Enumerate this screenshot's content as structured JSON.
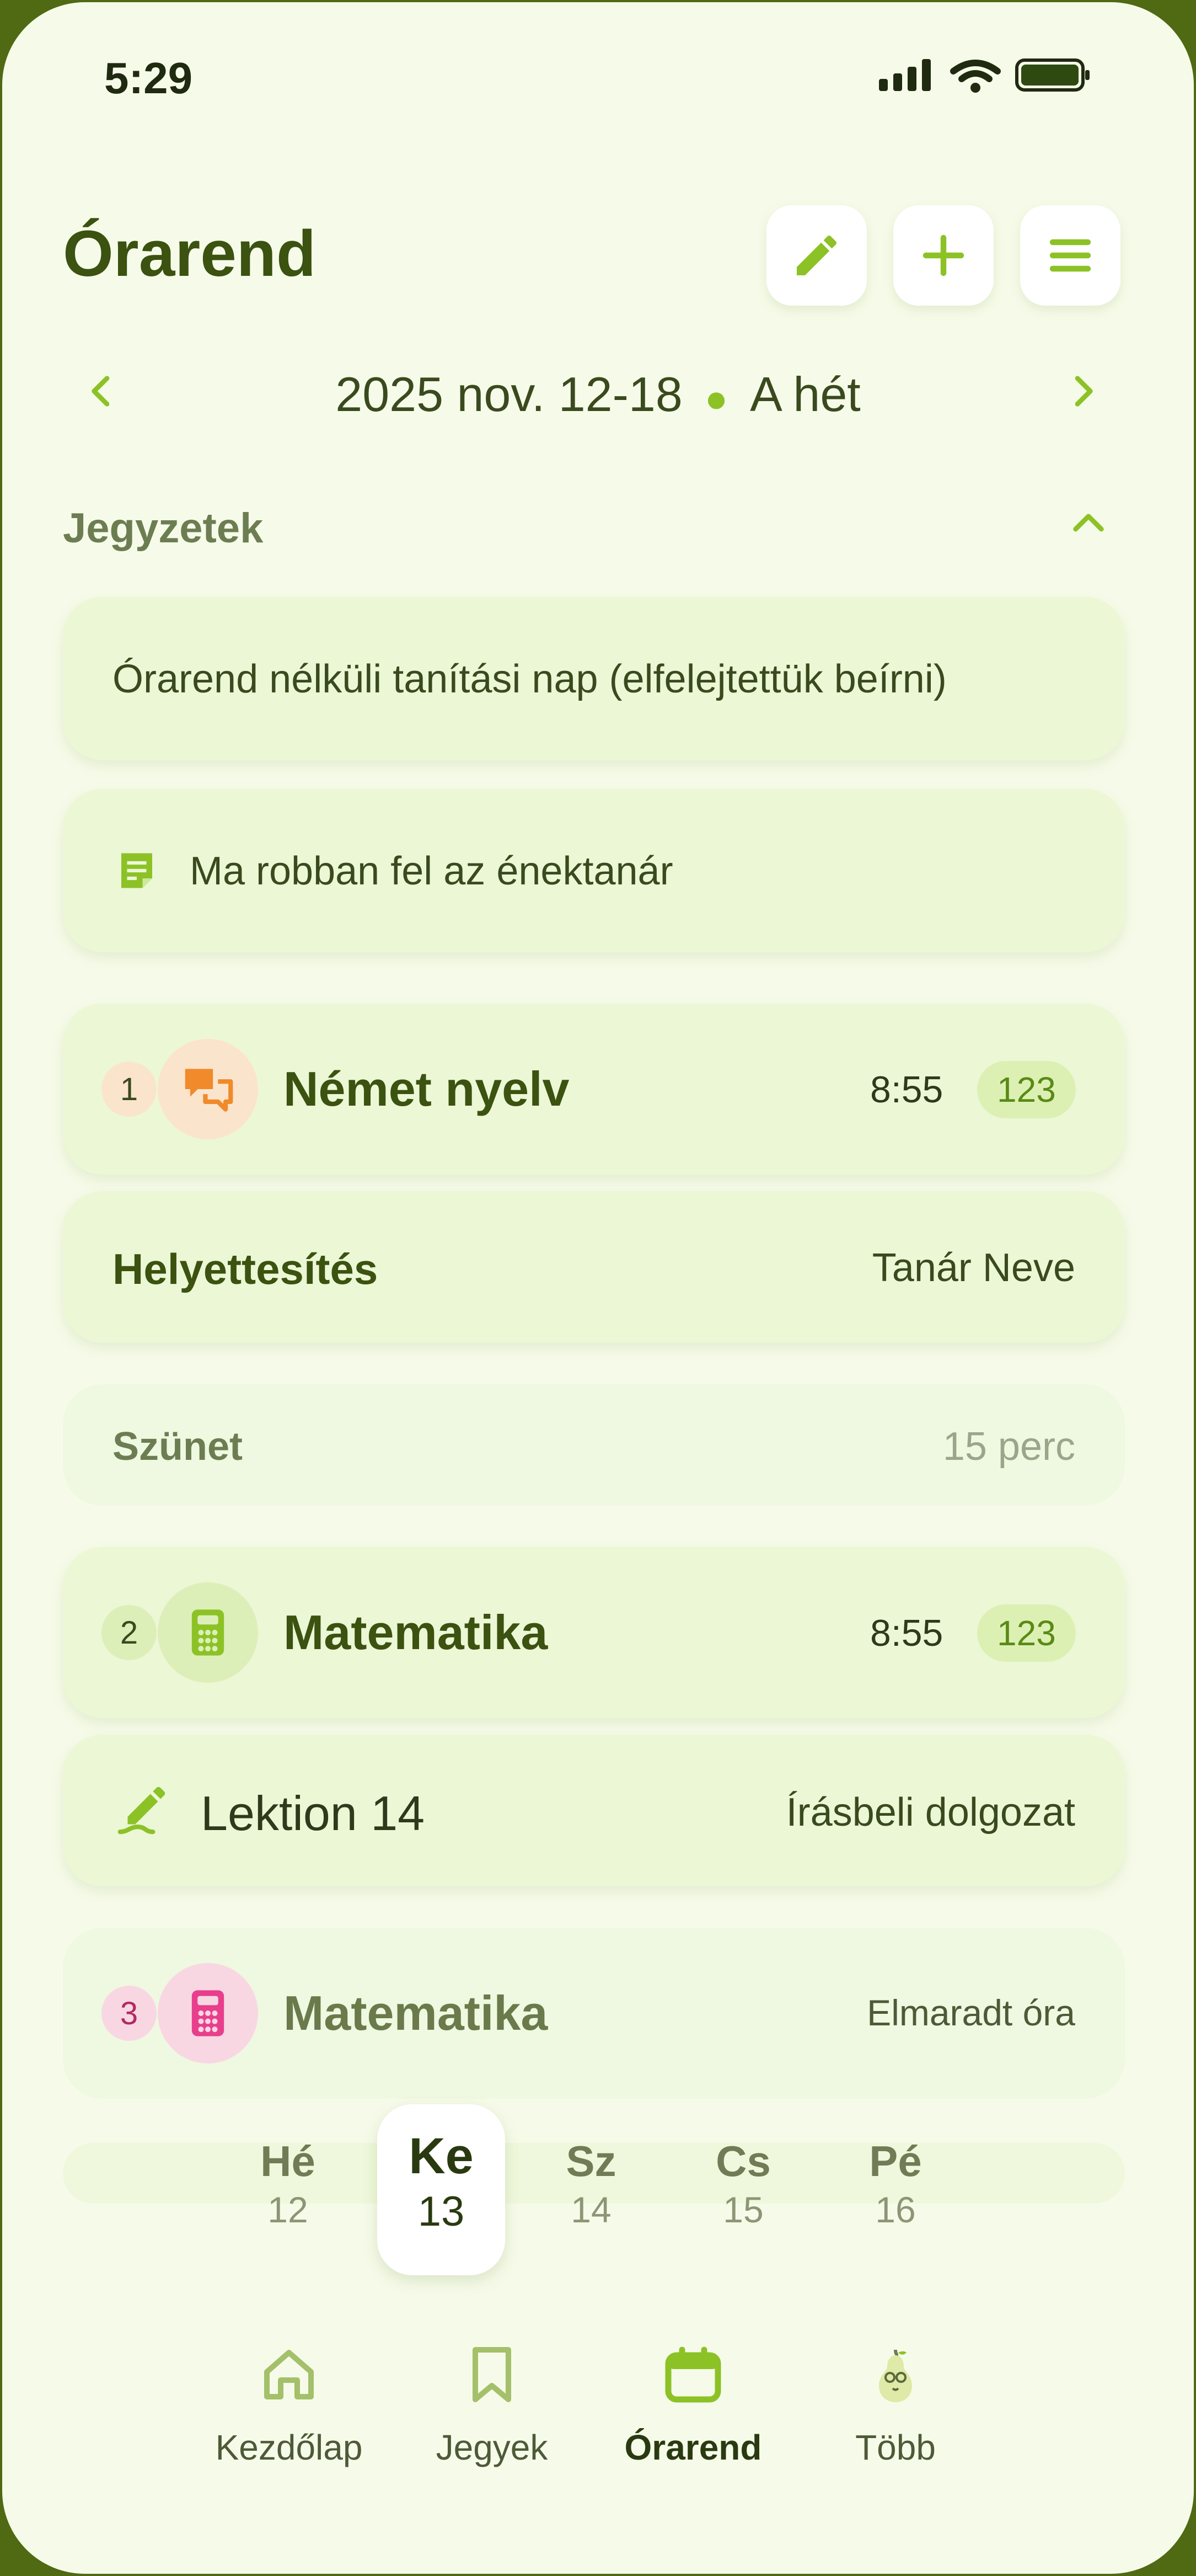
{
  "status_bar": {
    "time": "5:29"
  },
  "header": {
    "title": "Órarend"
  },
  "week": {
    "range": "2025 nov. 12-18",
    "week_name": "A hét"
  },
  "notes_section": {
    "title": "Jegyzetek"
  },
  "notes": [
    {
      "text": "Órarend nélküli tanítási nap (elfelejtettük beírni)"
    },
    {
      "text": "Ma robban fel az énektanár",
      "icon": "note-icon"
    }
  ],
  "lessons": [
    {
      "number": "1",
      "subject": "Német nyelv",
      "time": "8:55",
      "room": "123",
      "icon": "chat-bubbles-icon",
      "accent": "#f08a2a"
    },
    {
      "number": "2",
      "subject": "Matematika",
      "time": "8:55",
      "room": "123",
      "icon": "calculator-icon",
      "accent": "#8cc226"
    },
    {
      "number": "3",
      "subject": "Matematika",
      "status": "Elmaradt óra",
      "icon": "calculator-icon",
      "accent": "#e83e8c"
    }
  ],
  "substitution": {
    "label": "Helyettesítés",
    "teacher": "Tanár Neve"
  },
  "break": {
    "label": "Szünet",
    "duration": "15 perc"
  },
  "exam": {
    "title": "Lektion 14",
    "type": "Írásbeli dolgozat",
    "icon": "pen-icon"
  },
  "days": [
    {
      "name": "Hé",
      "date": "12"
    },
    {
      "name": "Ke",
      "date": "13",
      "selected": true
    },
    {
      "name": "Sz",
      "date": "14"
    },
    {
      "name": "Cs",
      "date": "15"
    },
    {
      "name": "Pé",
      "date": "16"
    }
  ],
  "tabs": [
    {
      "label": "Kezdőlap",
      "icon": "home-icon"
    },
    {
      "label": "Jegyek",
      "icon": "bookmark-icon"
    },
    {
      "label": "Órarend",
      "icon": "calendar-icon",
      "active": true
    },
    {
      "label": "Több",
      "icon": "pear-mascot-icon"
    }
  ],
  "colors": {
    "accent": "#8cc226",
    "title": "#3b5210",
    "background": "#f6fbe9",
    "card": "#ecf7d6",
    "frame": "#4f6a12"
  }
}
